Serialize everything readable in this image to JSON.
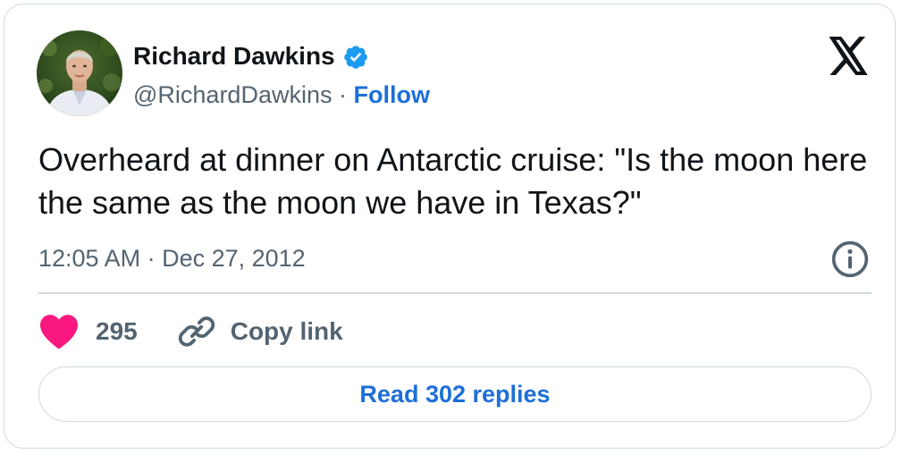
{
  "author": {
    "name": "Richard Dawkins",
    "handle": "@RichardDawkins",
    "separator": " · ",
    "follow_label": "Follow",
    "verified": true
  },
  "tweet": {
    "text": "Overheard at dinner on Antarctic cruise: \"Is the moon here the same as the moon we have in Texas?\"",
    "timestamp": "12:05 AM · Dec 27, 2012"
  },
  "actions": {
    "like_count": "295",
    "copy_link_label": "Copy link"
  },
  "replies_button_label": "Read 302 replies",
  "icons": {
    "brand": "x-logo-icon",
    "verified": "verified-badge-icon",
    "info": "info-icon",
    "like": "heart-icon",
    "copy": "link-icon"
  },
  "colors": {
    "link_blue": "#1d6fd8",
    "verified_blue": "#1d9bf0",
    "heart_pink": "#f91880",
    "muted_text": "#536471",
    "border": "#cfd9de"
  }
}
